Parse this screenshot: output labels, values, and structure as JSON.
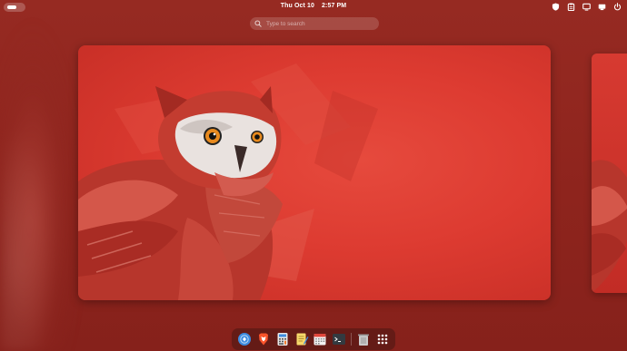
{
  "topbar": {
    "date": "Thu Oct 10",
    "time": "2:57 PM",
    "tray_icons": [
      "shield-icon",
      "clipboard-icon",
      "display-icon",
      "network-icon",
      "power-icon"
    ]
  },
  "search": {
    "placeholder": "Type to search"
  },
  "dock": {
    "items": [
      "web-browser-icon",
      "brave-browser-icon",
      "calculator-icon",
      "text-editor-icon",
      "calendar-icon",
      "terminal-icon",
      "trash-icon",
      "app-grid-icon"
    ]
  },
  "colors": {
    "background": "#902620",
    "wallpaper_red": "#dd3b31",
    "accent_blue": "#3d8bdf"
  }
}
